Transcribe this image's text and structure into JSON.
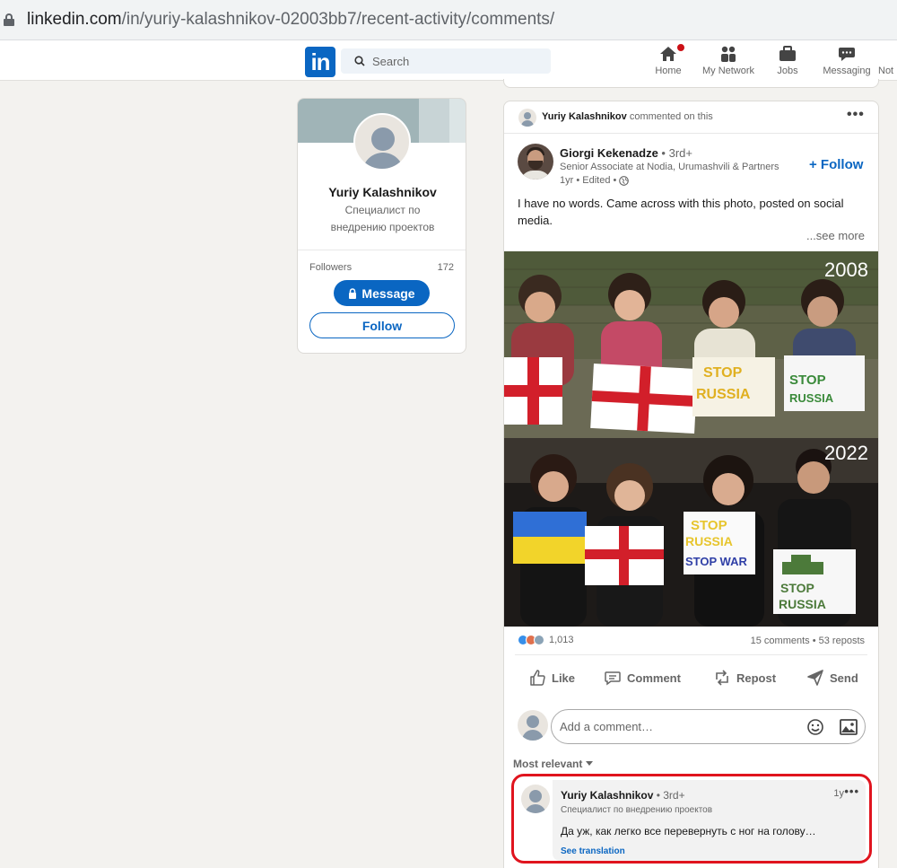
{
  "browser": {
    "url_host": "linkedin.com",
    "url_path": "/in/yuriy-kalashnikov-02003bb7/recent-activity/comments/"
  },
  "nav": {
    "logo": "in",
    "search_placeholder": "Search",
    "items": [
      {
        "label": "Home",
        "icon": "home-icon"
      },
      {
        "label": "My Network",
        "icon": "people-icon"
      },
      {
        "label": "Jobs",
        "icon": "briefcase-icon"
      },
      {
        "label": "Messaging",
        "icon": "chat-icon"
      },
      {
        "label": "Not",
        "icon": "bell-icon"
      }
    ]
  },
  "profile_card": {
    "name": "Yuriy Kalashnikov",
    "title": "Специалист по внедрению проектов",
    "followers_label": "Followers",
    "followers_count": "172",
    "message_label": "Message",
    "follow_label": "Follow"
  },
  "post": {
    "context_name": "Yuriy Kalashnikov",
    "context_action": " commented on this",
    "author_name": "Giorgi Kekenadze",
    "author_degree": " • 3rd+",
    "author_headline": "Senior Associate at Nodia, Urumashvili & Partners",
    "author_meta": "1yr • Edited •",
    "follow_label": "+ Follow",
    "text": "I have no words. Came across with this photo, posted on social media.",
    "see_more": "...see more",
    "image_year_top": "2008",
    "image_year_bottom": "2022",
    "reactions_count": "1,013",
    "comments_reposts": "15 comments • 53 reposts",
    "actions": {
      "like": "Like",
      "comment": "Comment",
      "repost": "Repost",
      "send": "Send"
    },
    "comment_placeholder": "Add a comment…",
    "sort_label": "Most relevant"
  },
  "comment": {
    "name": "Yuriy Kalashnikov",
    "degree": " • 3rd+",
    "headline": "Специалист по внедрению проектов",
    "time": "1y",
    "text": "Да уж, как легко все перевернуть с ног на голову…",
    "translate": "See translation"
  },
  "colors": {
    "brand": "#0a66c2",
    "highlight": "#e0141e",
    "notification": "#cc1016"
  }
}
